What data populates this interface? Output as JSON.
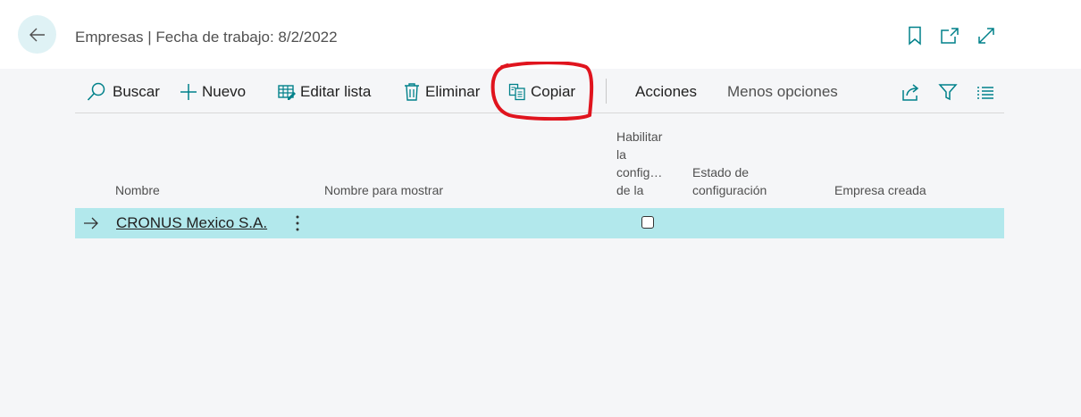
{
  "header": {
    "title": "Empresas | Fecha de trabajo: 8/2/2022",
    "icons": [
      "back-arrow-icon",
      "bookmark-icon",
      "open-new-window-icon",
      "expand-icon"
    ]
  },
  "toolbar": {
    "search_label": "Buscar",
    "new_label": "Nuevo",
    "edit_list_label": "Editar lista",
    "delete_label": "Eliminar",
    "copy_label": "Copiar",
    "actions_label": "Acciones",
    "less_options_label": "Menos opciones",
    "right_icons": [
      "share-icon",
      "filter-icon",
      "list-view-icon"
    ]
  },
  "columns": {
    "name": "Nombre",
    "display_name": "Nombre para mostrar",
    "enable_setup": [
      "Habilitar",
      "la",
      "config…",
      "de la"
    ],
    "setup_status": [
      "Estado de",
      "configuración"
    ],
    "company_created": "Empresa creada"
  },
  "rows": [
    {
      "name": "CRONUS Mexico S.A.",
      "display_name": "",
      "enable_setup": false,
      "setup_status": "",
      "company_created": ""
    }
  ],
  "colors": {
    "accent": "#00818a",
    "row_selected": "#b2e8ec",
    "annotation": "#e0141e"
  }
}
